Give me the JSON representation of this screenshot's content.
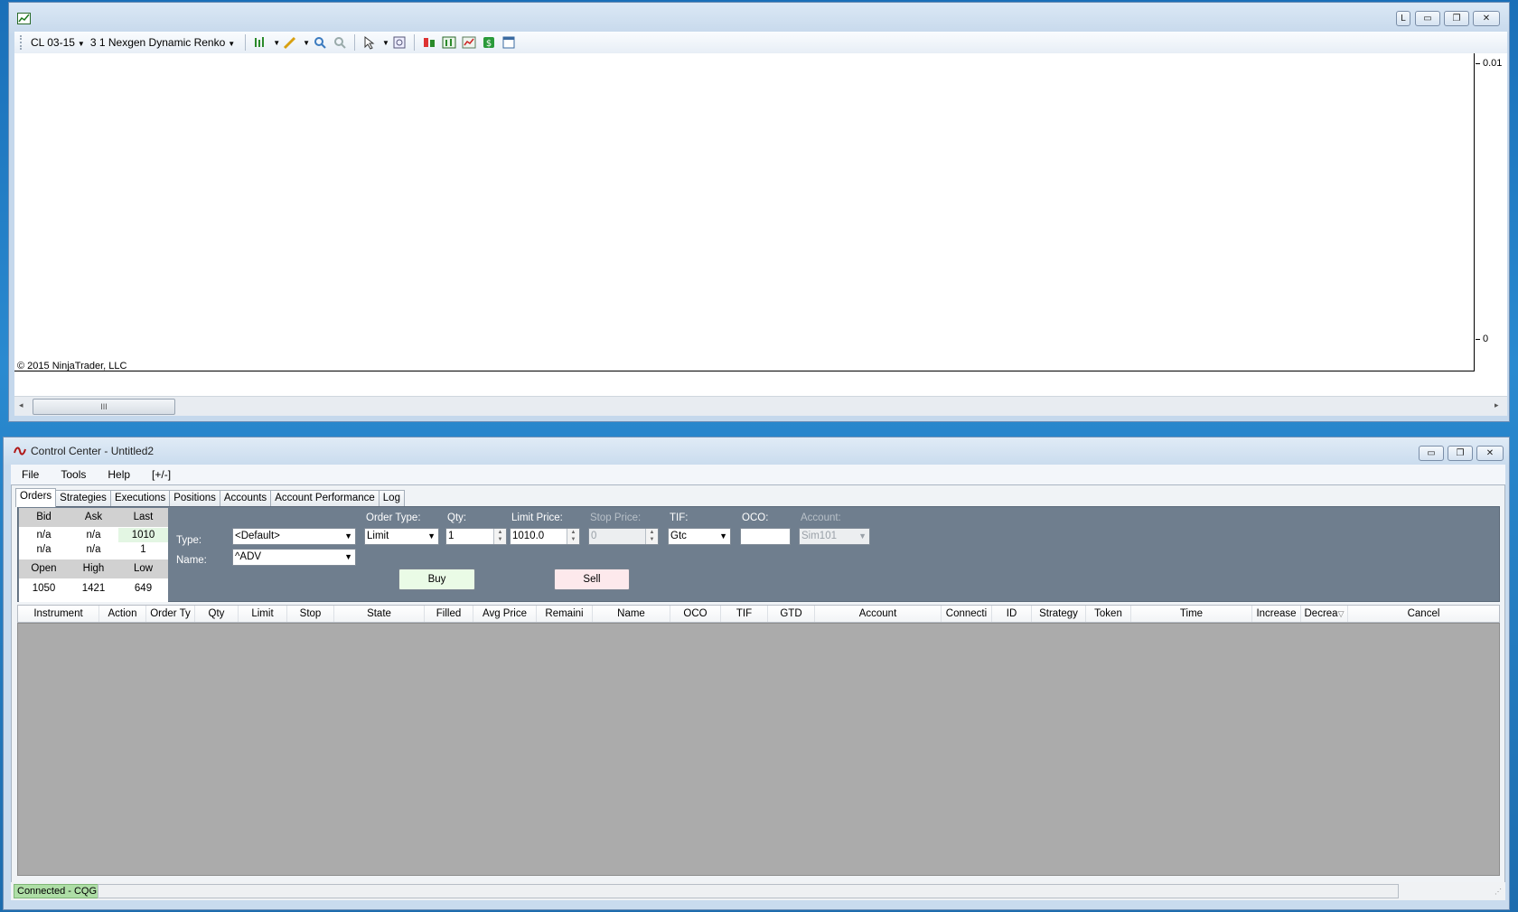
{
  "chart_window": {
    "caption_buttons": [
      "L",
      "▭",
      "❐",
      "✕"
    ],
    "toolbar": {
      "instrument": "CL 03-15",
      "period": "3 1 Nexgen Dynamic Renko",
      "icons": [
        "bar-type-icon",
        "drawing-tool-icon",
        "zoom-in-icon",
        "zoom-out-icon",
        "pointer-icon",
        "properties-icon",
        "strategies-icon",
        "indicators-icon",
        "chart-trader-icon",
        "dollar-icon",
        "data-box-icon"
      ]
    },
    "copyright": "© 2015 NinjaTrader, LLC",
    "y_axis": {
      "top_label": "0.01",
      "bottom_label": "0"
    },
    "scroll_thumb": "III",
    "scroll_left": "◂",
    "scroll_right": "▸"
  },
  "control_center": {
    "title": "Control Center - Untitled2",
    "caption_buttons": [
      "▭",
      "❐",
      "✕"
    ],
    "menu": [
      "File",
      "Tools",
      "Help",
      "[+/-]"
    ],
    "tabs": [
      "Orders",
      "Strategies",
      "Executions",
      "Positions",
      "Accounts",
      "Account Performance",
      "Log"
    ],
    "market": {
      "header1": [
        "Bid",
        "Ask",
        "Last"
      ],
      "row1": [
        "n/a",
        "n/a",
        "1010"
      ],
      "row2": [
        "n/a",
        "n/a",
        "1"
      ],
      "header2": [
        "Open",
        "High",
        "Low"
      ],
      "row3": [
        "1050",
        "1421",
        "649"
      ]
    },
    "order_entry": {
      "type_label": "Type:",
      "type_value": "<Default>",
      "name_label": "Name:",
      "name_value": "^ADV",
      "order_type_label": "Order Type:",
      "order_type_value": "Limit",
      "qty_label": "Qty:",
      "qty_value": "1",
      "limit_price_label": "Limit Price:",
      "limit_price_value": "1010.0",
      "stop_price_label": "Stop Price:",
      "stop_price_value": "0",
      "tif_label": "TIF:",
      "tif_value": "Gtc",
      "oco_label": "OCO:",
      "oco_value": "",
      "account_label": "Account:",
      "account_value": "Sim101",
      "buy_label": "Buy",
      "sell_label": "Sell"
    },
    "grid_columns": [
      "Instrument",
      "Action",
      "Order Ty",
      "Qty",
      "Limit",
      "Stop",
      "State",
      "Filled",
      "Avg Price",
      "Remaini",
      "Name",
      "OCO",
      "TIF",
      "GTD",
      "Account",
      "Connecti",
      "ID",
      "Strategy",
      "Token",
      "Time",
      "Increase",
      "Decrea",
      "Cancel"
    ],
    "sort_indicator": "▽",
    "status": {
      "connection": "Connected - CQG"
    },
    "colors": {
      "buy_bg": "#eafbe6",
      "sell_bg": "#fde9ec",
      "connected_bg": "#aedea6"
    }
  }
}
